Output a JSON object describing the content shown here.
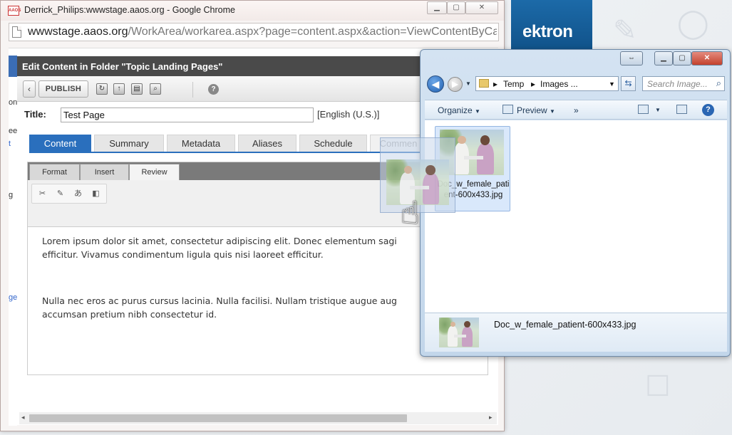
{
  "chrome": {
    "title": "Derrick_Philips:wwwstage.aaos.org - Google Chrome",
    "favicon_text": "AAOS",
    "url_host": "wwwstage.aaos.org",
    "url_path": "/WorkArea/workarea.aspx?page=content.aspx&action=ViewContentByCat"
  },
  "editor": {
    "header_title": "Edit Content in Folder \"Topic Landing Pages\"",
    "publish_label": "PUBLISH",
    "title_label": "Title:",
    "title_value": "Test Page",
    "language": "[English (U.S.)]",
    "tabs": [
      "Content",
      "Summary",
      "Metadata",
      "Aliases",
      "Schedule",
      "Commen"
    ],
    "ribbon_tabs": [
      "Format",
      "Insert",
      "Review"
    ],
    "paragraphs": [
      "Lorem ipsum dolor sit amet, consectetur adipiscing elit. Donec elementum sagi\nefficitur. Vivamus condimentum ligula quis nisi laoreet efficitur.",
      "Nulla nec eros ac purus cursus lacinia. Nulla facilisi. Nullam tristique augue aug\naccumsan pretium nibh consectetur id."
    ]
  },
  "left_strip": [
    "on",
    "ee",
    "t",
    "g",
    "ge"
  ],
  "logo": {
    "text": "ektron"
  },
  "explorer": {
    "breadcrumb": [
      "Temp",
      "Images ..."
    ],
    "search_placeholder": "Search Image...",
    "organize_label": "Organize",
    "preview_label": "Preview",
    "more_label": "»",
    "file_name": "Doc_w_female_patient-600x433.jpg",
    "detail_name": "Doc_w_female_patient-600x433.jpg"
  }
}
